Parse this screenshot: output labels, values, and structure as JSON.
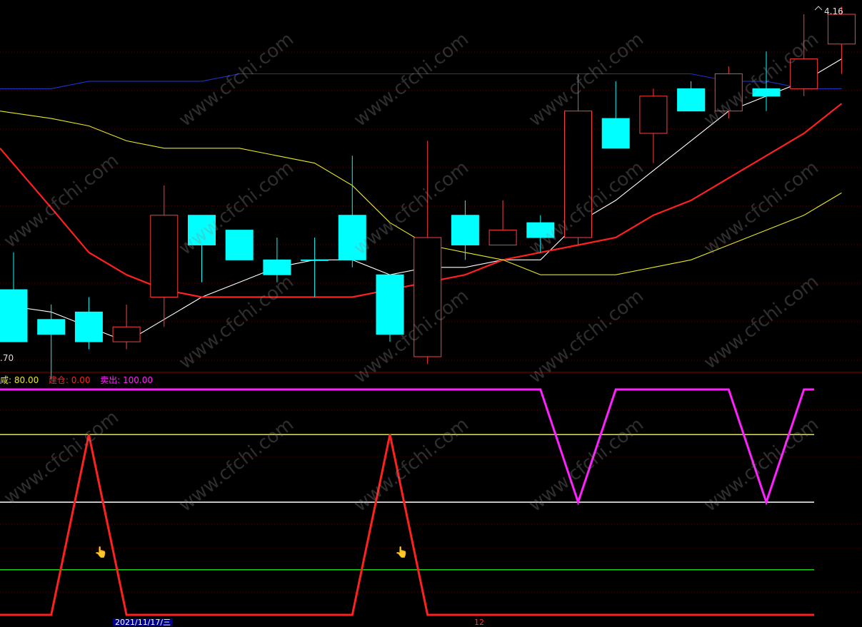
{
  "chart_data": [
    {
      "type": "candlestick",
      "price_axis": {
        "top_label": "4.16",
        "bottom_label": ".70"
      },
      "candles": [
        {
          "o": 3.72,
          "c": 3.79,
          "h": 3.84,
          "l": 3.72,
          "bull": false
        },
        {
          "o": 3.73,
          "c": 3.75,
          "h": 3.77,
          "l": 3.67,
          "bull": false
        },
        {
          "o": 3.76,
          "c": 3.72,
          "h": 3.78,
          "l": 3.71,
          "bull": false
        },
        {
          "o": 3.74,
          "c": 3.72,
          "h": 3.77,
          "l": 3.71,
          "bull": true
        },
        {
          "o": 3.78,
          "c": 3.89,
          "h": 3.93,
          "l": 3.74,
          "bull": true
        },
        {
          "o": 3.89,
          "c": 3.85,
          "h": 3.89,
          "l": 3.8,
          "bull": false
        },
        {
          "o": 3.87,
          "c": 3.83,
          "h": 3.87,
          "l": 3.83,
          "bull": false
        },
        {
          "o": 3.83,
          "c": 3.81,
          "h": 3.86,
          "l": 3.8,
          "bull": false
        },
        {
          "o": 3.83,
          "c": 3.83,
          "h": 3.86,
          "l": 3.78,
          "bull": false
        },
        {
          "o": 3.89,
          "c": 3.83,
          "h": 3.97,
          "l": 3.82,
          "bull": false
        },
        {
          "o": 3.81,
          "c": 3.73,
          "h": 3.81,
          "l": 3.72,
          "bull": false
        },
        {
          "o": 3.7,
          "c": 3.86,
          "h": 3.99,
          "l": 3.69,
          "bull": true
        },
        {
          "o": 3.89,
          "c": 3.85,
          "h": 3.91,
          "l": 3.83,
          "bull": false
        },
        {
          "o": 3.85,
          "c": 3.87,
          "h": 3.91,
          "l": 3.85,
          "bull": true
        },
        {
          "o": 3.88,
          "c": 3.86,
          "h": 3.89,
          "l": 3.84,
          "bull": false
        },
        {
          "o": 3.86,
          "c": 4.03,
          "h": 4.08,
          "l": 3.85,
          "bull": true
        },
        {
          "o": 4.02,
          "c": 3.98,
          "h": 4.07,
          "l": 3.98,
          "bull": false
        },
        {
          "o": 4.0,
          "c": 4.05,
          "h": 4.06,
          "l": 3.96,
          "bull": true
        },
        {
          "o": 4.06,
          "c": 4.03,
          "h": 4.07,
          "l": 4.03,
          "bull": false
        },
        {
          "o": 4.03,
          "c": 4.08,
          "h": 4.09,
          "l": 4.02,
          "bull": true
        },
        {
          "o": 4.06,
          "c": 4.05,
          "h": 4.11,
          "l": 4.03,
          "bull": false
        },
        {
          "o": 4.06,
          "c": 4.1,
          "h": 4.16,
          "l": 4.05,
          "bull": true
        },
        {
          "o": 4.12,
          "c": 4.16,
          "h": 4.17,
          "l": 4.08,
          "bull": true
        }
      ],
      "ma_lines": [
        {
          "color": "#ffffff",
          "values": [
            3.77,
            3.76,
            3.74,
            3.72,
            3.75,
            3.78,
            3.8,
            3.82,
            3.83,
            3.83,
            3.81,
            3.82,
            3.82,
            3.83,
            3.83,
            3.88,
            3.91,
            3.95,
            3.99,
            4.03,
            4.05,
            4.07,
            4.1
          ]
        },
        {
          "color": "#ff2020",
          "values": [
            3.98,
            3.9,
            3.84,
            3.81,
            3.79,
            3.78,
            3.78,
            3.78,
            3.78,
            3.78,
            3.79,
            3.8,
            3.81,
            3.83,
            3.84,
            3.85,
            3.86,
            3.89,
            3.91,
            3.94,
            3.97,
            4.0,
            4.04
          ]
        },
        {
          "color": "#e8e820",
          "values": [
            4.03,
            4.02,
            4.01,
            3.99,
            3.98,
            3.98,
            3.98,
            3.97,
            3.96,
            3.93,
            3.88,
            3.85,
            3.84,
            3.83,
            3.81,
            3.81,
            3.81,
            3.82,
            3.83,
            3.85,
            3.87,
            3.89,
            3.92
          ]
        },
        {
          "color": "#2030d0",
          "values": [
            4.06,
            4.06,
            4.07,
            4.07,
            4.07,
            4.07,
            4.08,
            4.08,
            4.08,
            4.08,
            4.08,
            4.08,
            4.08,
            4.08,
            4.08,
            4.08,
            4.08,
            4.08,
            4.08,
            4.07,
            4.07,
            4.06,
            4.06
          ]
        }
      ]
    },
    {
      "type": "line",
      "legend": [
        {
          "label": "咸:",
          "value": "80.00",
          "label_color": "#e8e820",
          "value_color": "#e8e820"
        },
        {
          "label": "建仓:",
          "value": "0.00",
          "label_color": "#ff2020",
          "value_color": "#ff2020"
        },
        {
          "label": "卖出:",
          "value": "100.00",
          "label_color": "#ff20ff",
          "value_color": "#ff20ff"
        }
      ],
      "ylim": [
        0,
        100
      ],
      "reference_lines": [
        {
          "value": 80,
          "color": "#e8e820"
        },
        {
          "value": 50,
          "color": "#ffffff"
        },
        {
          "value": 20,
          "color": "#20d020"
        }
      ],
      "series": [
        {
          "color": "#ff2020",
          "values": [
            0,
            0,
            80,
            0,
            0,
            0,
            0,
            0,
            0,
            0,
            80,
            0,
            0,
            0,
            0,
            0,
            0,
            0,
            0,
            0,
            0,
            0,
            0
          ]
        },
        {
          "color": "#ff20ff",
          "values": [
            100,
            100,
            100,
            100,
            100,
            100,
            100,
            100,
            100,
            100,
            100,
            100,
            100,
            100,
            100,
            50,
            100,
            100,
            100,
            100,
            50,
            100,
            100
          ]
        }
      ]
    }
  ],
  "watermark": "www.cfchi.com",
  "bottom_axis": {
    "date_label": "2021/11/17/三",
    "marker_label": "12"
  },
  "icons": [
    "pointing-hand-icon",
    "pointing-hand-icon"
  ]
}
